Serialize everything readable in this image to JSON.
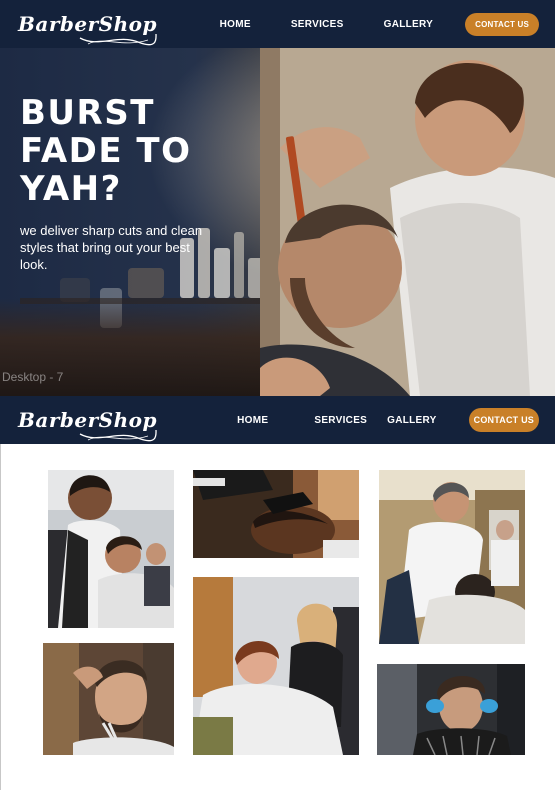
{
  "header": {
    "logo": "BarberShop",
    "nav": [
      "HOME",
      "SERVICES",
      "GALLERY"
    ],
    "contact": "CONTACT US"
  },
  "hero": {
    "title_lines": [
      "BURST",
      "FADE TO",
      "YAH?"
    ],
    "subtitle": "we deliver sharp cuts and clean styles that bring out your best look."
  },
  "frame_label": "Desktop - 7",
  "header2": {
    "logo": "BarberShop",
    "nav": [
      "HOME",
      "SERVICES",
      "GALLERY"
    ],
    "contact": "CONTACT US"
  },
  "colors": {
    "nav_bg": "#14223b",
    "accent": "#c98028"
  }
}
